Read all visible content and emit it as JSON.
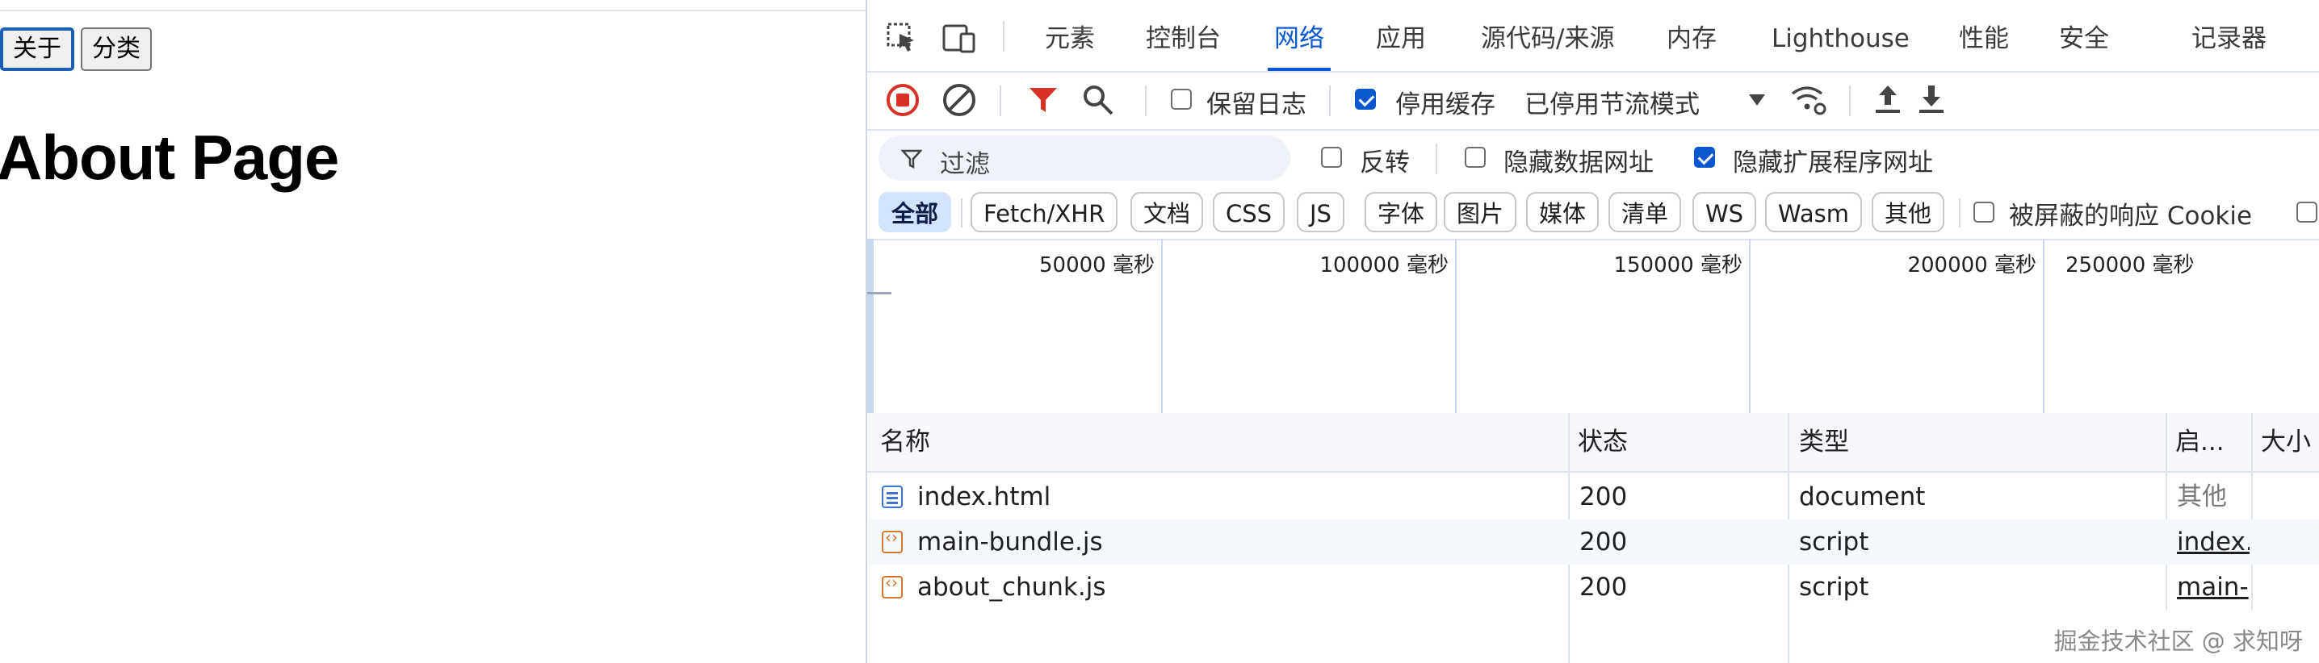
{
  "page": {
    "nav": {
      "about": "关于",
      "category": "分类"
    },
    "heading": "About Page"
  },
  "devtools": {
    "tabs": [
      "元素",
      "控制台",
      "网络",
      "应用",
      "源代码/来源",
      "内存",
      "Lighthouse",
      "性能",
      "安全",
      "记录器"
    ],
    "active_tab": "网络",
    "toolbar": {
      "preserve_log": "保留日志",
      "disable_cache": "停用缓存",
      "throttle": "已停用节流模式"
    },
    "filter": {
      "placeholder": "过滤",
      "invert": "反转",
      "hide_data_urls": "隐藏数据网址",
      "hide_ext_urls": "隐藏扩展程序网址"
    },
    "chips": [
      "全部",
      "Fetch/XHR",
      "文档",
      "CSS",
      "JS",
      "字体",
      "图片",
      "媒体",
      "清单",
      "WS",
      "Wasm",
      "其他"
    ],
    "blocked_cookies": "被屏蔽的响应 Cookie",
    "timeline_ticks": [
      "50000 毫秒",
      "100000 毫秒",
      "150000 毫秒",
      "200000 毫秒",
      "250000 毫秒"
    ],
    "columns": {
      "name": "名称",
      "status": "状态",
      "type": "类型",
      "initiator": "启...",
      "size": "大小"
    },
    "rows": [
      {
        "name": "index.html",
        "status": "200",
        "type": "document",
        "initiator": "其他",
        "icon": "document-file-icon"
      },
      {
        "name": "main-bundle.js",
        "status": "200",
        "type": "script",
        "initiator": "index.",
        "icon": "script-file-icon"
      },
      {
        "name": "about_chunk.js",
        "status": "200",
        "type": "script",
        "initiator": "main-",
        "icon": "script-file-icon"
      }
    ],
    "colors": {
      "accent": "#0b57d0",
      "record_red": "#d93025"
    }
  },
  "watermark": "掘金技术社区 @ 求知呀"
}
